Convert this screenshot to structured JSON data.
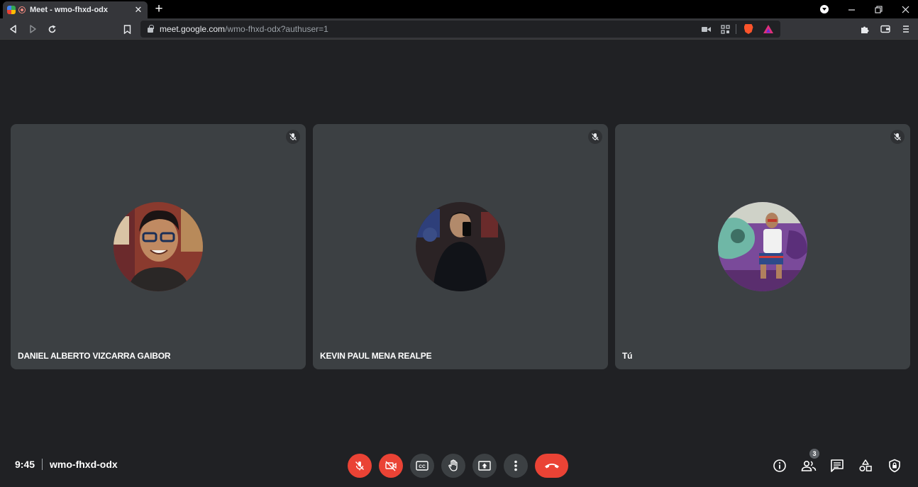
{
  "browser": {
    "tab_title": "Meet - wmo-fhxd-odx",
    "url_host": "meet.google.com",
    "url_path": "/wmo-fhxd-odx?authuser=1"
  },
  "participants": [
    {
      "name": "DANIEL ALBERTO VIZCARRA GAIBOR",
      "muted": true
    },
    {
      "name": "KEVIN PAUL MENA REALPE",
      "muted": true
    },
    {
      "name": "Tú",
      "muted": true
    }
  ],
  "meeting": {
    "time": "9:45",
    "code": "wmo-fhxd-odx",
    "participant_count": "3"
  },
  "colors": {
    "background": "#202124",
    "tile": "#3c4043",
    "danger": "#ea4335"
  }
}
